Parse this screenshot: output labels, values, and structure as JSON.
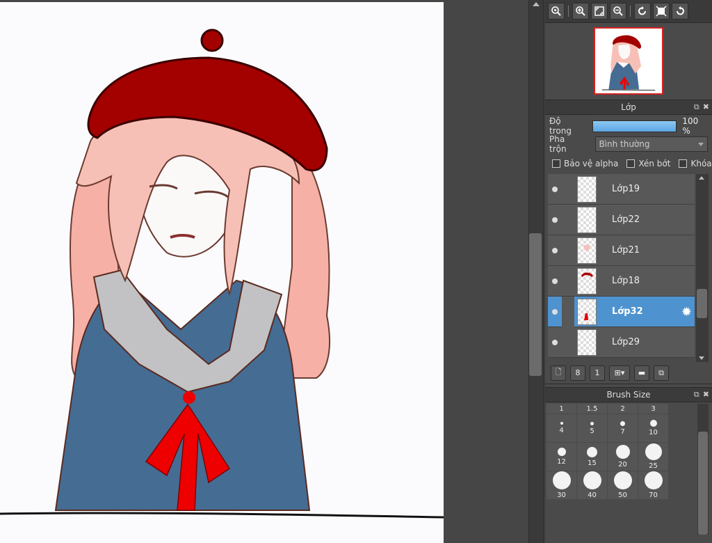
{
  "navigator_toolbar": {
    "buttons": [
      "zoom-fit-icon",
      "zoom-in-icon",
      "fit-screen-icon",
      "zoom-out-icon",
      "rotate-left-icon",
      "reset-view-icon",
      "rotate-right-icon"
    ]
  },
  "layer_panel": {
    "title": "Lớp",
    "opacity_label": "Độ trong",
    "opacity_value": "100 %",
    "opacity_fraction": 1.0,
    "blend_label": "Pha trộn",
    "blend_value": "Bình thường",
    "checkboxes": {
      "protect_alpha": "Bảo vệ alpha",
      "clipping": "Xén bớt",
      "lock": "Khóa"
    },
    "layers": [
      {
        "name": "Lớp19",
        "selected": false
      },
      {
        "name": "Lớp22",
        "selected": false
      },
      {
        "name": "Lớp21",
        "selected": false
      },
      {
        "name": "Lớp18",
        "selected": false
      },
      {
        "name": "Lớp32",
        "selected": true
      },
      {
        "name": "Lớp29",
        "selected": false
      }
    ]
  },
  "brush_panel": {
    "title": "Brush Size",
    "header_sizes": [
      "1",
      "1.5",
      "2",
      "3"
    ],
    "rows": [
      [
        "4",
        "5",
        "7",
        "10"
      ],
      [
        "12",
        "15",
        "20",
        "25"
      ],
      [
        "30",
        "40",
        "50",
        "70"
      ]
    ]
  },
  "colors": {
    "selection": "#4e93cf",
    "opacity_fill": "#6fb4ea",
    "accent_red": "#d62020"
  }
}
